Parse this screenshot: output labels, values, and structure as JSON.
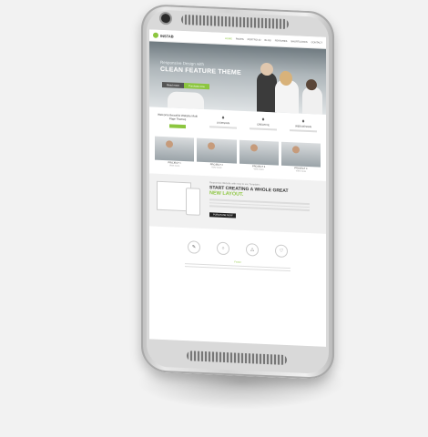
{
  "app": {
    "logo_text": "INSTAB",
    "nav": [
      "HOME",
      "PAGES",
      "PORTFOLIO",
      "BLOG",
      "FEATURES",
      "SHORTCODES",
      "CONTACT"
    ]
  },
  "hero": {
    "subtitle": "Responsive Design with",
    "title": "CLEAN FEATURE THEME",
    "button_primary": "Read more",
    "button_secondary": "Purchase now"
  },
  "intro": {
    "title": "Welcome Beautiful Website Multi Page Themes",
    "features": [
      {
        "icon": "diamond-icon",
        "glyph": "♦",
        "label": "UI DESIGN"
      },
      {
        "icon": "diamond-icon",
        "glyph": "♦",
        "label": "CREATIVE"
      },
      {
        "icon": "diamond-icon",
        "glyph": "♦",
        "label": "WEB DESIGN"
      }
    ]
  },
  "team": [
    {
      "label": "PROJECT 1",
      "link": "View more"
    },
    {
      "label": "PROJECT 2",
      "link": "View more"
    },
    {
      "label": "PROJECT 3",
      "link": "View more"
    },
    {
      "label": "PROJECT 4",
      "link": "View more"
    }
  ],
  "promo": {
    "small": "Responsive Website with easy to use Templates",
    "title": "START CREATING A WHOLE GREAT",
    "title_accent": "NEW LAYOUT.",
    "button": "PURCHASE NOW"
  },
  "icons_row": [
    {
      "icon": "tool-icon",
      "glyph": "✎"
    },
    {
      "icon": "globe-icon",
      "glyph": "○"
    },
    {
      "icon": "rocket-icon",
      "glyph": "△"
    },
    {
      "icon": "heart-icon",
      "glyph": "♡"
    }
  ],
  "footer": {
    "text": "Footer"
  },
  "colors": {
    "accent": "#8cc63f",
    "dark": "#222222"
  }
}
